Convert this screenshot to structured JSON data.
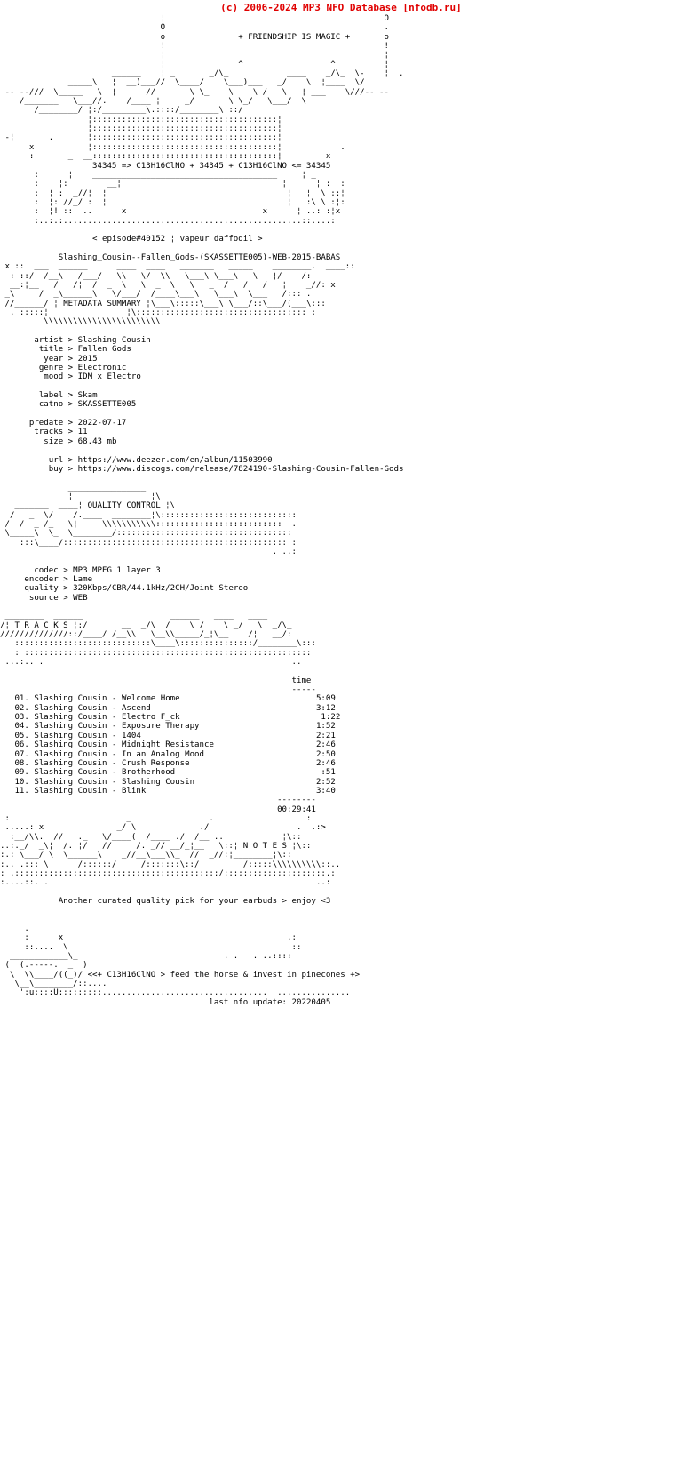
{
  "banner": {
    "text": "(c) 2006-2024 MP3 NFO Database [nfodb.ru]",
    "color": "#e00000"
  },
  "header": {
    "tagline": "+ FRIENDSHIP IS MAGIC +",
    "formula_line": "34345 => C13H16ClNO + 34345 + C13H16ClNO <= 34345",
    "episode": "< episode#40152 ¦ vapeur daffodil >",
    "release": "Slashing_Cousin--Fallen_Gods-(SKASSETTE005)-WEB-2015-BABAS"
  },
  "sections": {
    "metadata_title": "METADATA SUMMARY",
    "quality_title": "QUALITY CONTROL",
    "tracks_title": "T R A C K S",
    "notes_title": "N O T E S"
  },
  "metadata": {
    "rows": [
      {
        "label": "artist",
        "sep": ">",
        "value": "Slashing Cousin"
      },
      {
        "label": "title",
        "sep": ">",
        "value": "Fallen Gods"
      },
      {
        "label": "year",
        "sep": ">",
        "value": "2015"
      },
      {
        "label": "genre",
        "sep": ">",
        "value": "Electronic"
      },
      {
        "label": "mood",
        "sep": ">",
        "value": "IDM x Electro"
      }
    ],
    "label_rows": [
      {
        "label": "label",
        "sep": ">",
        "value": "Skam"
      },
      {
        "label": "catno",
        "sep": ">",
        "value": "SKASSETTE005"
      }
    ],
    "release_rows": [
      {
        "label": "predate",
        "sep": ">",
        "value": "2022-07-17"
      },
      {
        "label": "tracks",
        "sep": ">",
        "value": "11"
      },
      {
        "label": "size",
        "sep": ">",
        "value": "68.43 mb"
      }
    ],
    "link_rows": [
      {
        "label": "url",
        "sep": ">",
        "value": "https://www.deezer.com/en/album/11503990"
      },
      {
        "label": "buy",
        "sep": ">",
        "value": "https://www.discogs.com/release/7824190-Slashing-Cousin-Fallen-Gods"
      }
    ]
  },
  "quality": {
    "rows": [
      {
        "label": "codec",
        "sep": ">",
        "value": "MP3 MPEG 1 layer 3"
      },
      {
        "label": "encoder",
        "sep": ">",
        "value": "Lame"
      },
      {
        "label": "quality",
        "sep": ">",
        "value": "320Kbps/CBR/44.1kHz/2CH/Joint Stereo"
      },
      {
        "label": "source",
        "sep": ">",
        "value": "WEB"
      }
    ]
  },
  "tracklist": {
    "time_header": "time",
    "rule": "-----",
    "tracks": [
      {
        "num": "01.",
        "artist": "Slashing Cousin",
        "dash": "-",
        "title": "Welcome Home",
        "time": "5:09"
      },
      {
        "num": "02.",
        "artist": "Slashing Cousin",
        "dash": "-",
        "title": "Ascend",
        "time": "3:12"
      },
      {
        "num": "03.",
        "artist": "Slashing Cousin",
        "dash": "-",
        "title": "Electro F_ck",
        "time": "1:22"
      },
      {
        "num": "04.",
        "artist": "Slashing Cousin",
        "dash": "-",
        "title": "Exposure Therapy",
        "time": "1:52"
      },
      {
        "num": "05.",
        "artist": "Slashing Cousin",
        "dash": "-",
        "title": "1404",
        "time": "2:21"
      },
      {
        "num": "06.",
        "artist": "Slashing Cousin",
        "dash": "-",
        "title": "Midnight Resistance",
        "time": "2:46"
      },
      {
        "num": "07.",
        "artist": "Slashing Cousin",
        "dash": "-",
        "title": "In an Analog Mood",
        "time": "2:50"
      },
      {
        "num": "08.",
        "artist": "Slashing Cousin",
        "dash": "-",
        "title": "Crush Response",
        "time": "2:46"
      },
      {
        "num": "09.",
        "artist": "Slashing Cousin",
        "dash": "-",
        "title": "Brotherhood",
        "time": ":51"
      },
      {
        "num": "10.",
        "artist": "Slashing Cousin",
        "dash": "-",
        "title": "Slashing Cousin",
        "time": "2:52"
      },
      {
        "num": "11.",
        "artist": "Slashing Cousin",
        "dash": "-",
        "title": "Blink",
        "time": "3:40"
      }
    ],
    "total_rule": "--------",
    "total_time": "00:29:41"
  },
  "notes": {
    "text": "Another curated quality pick for your earbuds > enjoy <3"
  },
  "footer": {
    "signature": "<<+ C13H16ClNO > feed the horse & invest in pinecones +>",
    "last_update_label": "last nfo update:",
    "last_update_value": "20220405"
  },
  "ascii": {
    "head_art": "                                 ¦                                             O\n                                 O                                             .\n                                 o               + FRIENDSHIP IS MAGIC +       o\n                                 !                                             !\n                                 ¦                                             ¦\n                                 ¦               ^                  ^          ¦\n                       ______    ¦ _       _/\\_            ____    _/\\_  \\-    ¦  .\n              _____\\   ¦  __)___//  \\____/    \\___)___   _/    \\  ¦____  \\/\n -- --///  \\_____   \\  ¦      //       \\ \\_    \\    \\ /   \\   ¦ ___    \\///-- --\n    /_______   \\___//.    /____ ¦     _/       \\ \\_/   \\___/  \\\n       /________/ ¦:/_________\\.::::/________\\ ::/\n                  ¦::::::::::::::::::::::::::::::::::::::¦\n                  ¦::::::::::::::::::::::::::::::::::::::¦\n -¦       .       ¦::::::::::::::::::::::::::::::::::::::¦\n      x           ¦::::::::::::::::::::::::::::::::::::::¦            .\n      :       _  __::::::::::::::::::::::::::::::::::::::¦         x\n",
    "metadata_art": " x ::  ___  ______      ____  ____   _______   _____    ________.  ____::\n  : ::/  /__\\   /___/   \\\\   \\/  \\\\   \\___\\ \\___\\   \\   ¦/    /:\n  __:¦__   /   /¦  /  _  \\   \\  _  \\   \\   _  /   /   /   ¦    _//: x\n _\\     /  _\\______\\   \\/___/  /____\\___\\   \\___\\  \\___   /::: .\n //______/ ¦ METADATA SUMMARY ¦\\___\\:::::\\___\\ \\___/::\\___/(___\\:::\n  . :::::¦________________¦\\::::::::::::::::::::::::::::::::::: :\n         \\\\\\\\\\\\\\\\\\\\\\\\\\\\\\\\\\\\",
    "quality_art": "              ________________\n              ¦                ¦\\\n   _______  ____¦ QUALITY CONTROL ¦\\\n  /   _  \\/    /.____  ________¦\\::::::::::::::::::::::::::::\n /  /  _ /_   \\¦     \\\\\\\\\\\\\\\\\\\\\\::::::::::::::::::::::::::  .\n \\_____\\  \\_  \\________/::::::::::::::::::::::::::::::::::::\n    :::\\____/:::::::::::::::::::::::::::::::::::::::::::::: :\n                                                        . ..:",
    "tracks_art": " ________  ______                  ______   ____   ____\n/¦ T R A C K S ¦:/       __  _/\\  /    \\ /    \\ _/   \\  _/\\_\n//////////////::/____/ /__\\\\   \\__\\\\_____/_¦\\__    /¦   __/:\n   ::::::::::::::::::::::::::::\\____\\:::::::::::::::/________\\:::\n   : :::::::::::::::::::::::::::::::::::::::::::::::::::::::::::\n ...:.. .                                                   ..",
    "notes_art": " :                        _                .                   :\n .....: x               _/ \\             ./                  .  .:>\n  :__/\\\\.  //   ._   \\/____(  /____ ./  /__ ..¦           ¦\\::\n..:._/  _\\¦  /. ¦/   //     /. _// __/_¦__   \\::¦ N O T E S ¦\\::\n:.: \\___/ \\  \\______\\    _//__\\___\\\\_  //  _//:¦________¦\\::\n:.. .::: \\______/::::::/_____/:::::::\\::/_________/:::::\\\\\\\\\\\\\\\\\\\\::..\n: .::::::::::::::::::::::::::::::::::::::::::/:::::::::::::::::::::.:\n:....::. .                                                       ..:",
    "footer_art": "     .\n     :      x                                              .:\n     ::....  \\                                              ::\n  ____________\\_                              . .   . ..::::\n (  (.-----.  _  )\n  \\  \\\\____/((_)/",
    "footer_art_tail": "   \\__\\________/::....\n    ':u::::U:::::::::..................................  ..............."
  }
}
